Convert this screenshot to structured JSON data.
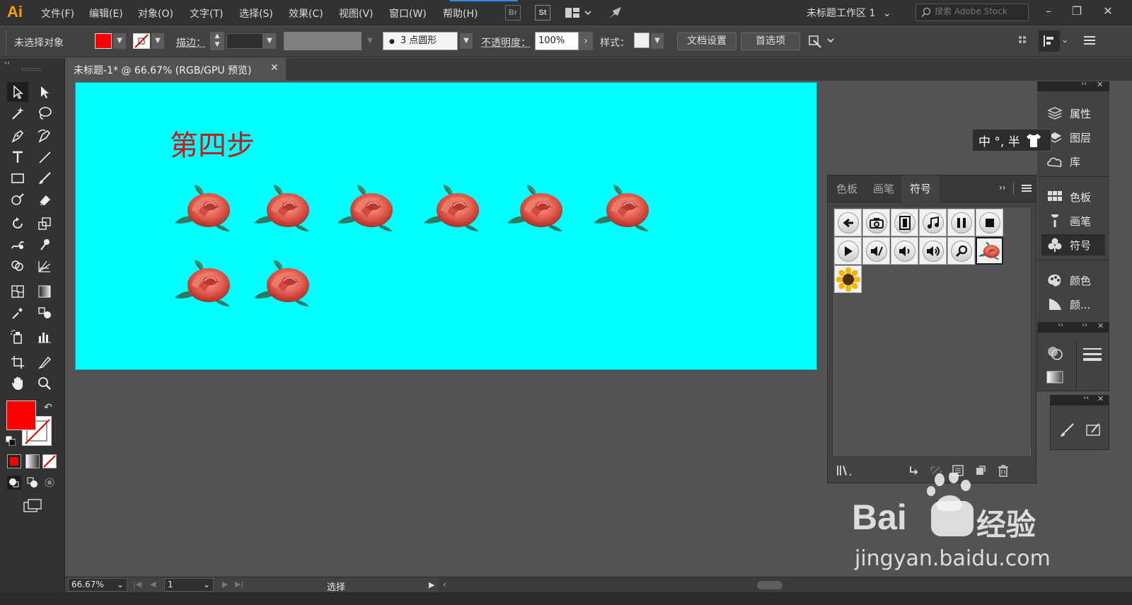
{
  "app": {
    "logo": "Ai"
  },
  "menu": {
    "items": [
      "文件(F)",
      "编辑(E)",
      "对象(O)",
      "文字(T)",
      "选择(S)",
      "效果(C)",
      "视图(V)",
      "窗口(W)",
      "帮助(H)"
    ],
    "bridge_label": "Br",
    "stock_label": "St",
    "workspace": "未标题工作区 1",
    "search_placeholder": "搜索 Adobe Stock"
  },
  "control": {
    "selection_status": "未选择对象",
    "fill_color": "#ff0000",
    "stroke_label": "描边：",
    "brush_profile": "3 点圆形",
    "opacity_label": "不透明度：",
    "opacity_value": "100%",
    "style_label": "样式：",
    "doc_setup_button": "文档设置",
    "preferences_button": "首选项"
  },
  "document": {
    "tab_title": "未标题-1* @ 66.67% (RGB/GPU 预览)",
    "artboard_color": "#00ffff",
    "heading": "第四步",
    "heading_color": "#c01d1d"
  },
  "dock": {
    "items": [
      {
        "label": "属性",
        "icon": "properties-icon"
      },
      {
        "label": "图层",
        "icon": "layers-icon"
      },
      {
        "label": "库",
        "icon": "libraries-icon"
      },
      {
        "label": "色板",
        "icon": "swatches-icon"
      },
      {
        "label": "画笔",
        "icon": "brushes-icon"
      },
      {
        "label": "符号",
        "icon": "symbols-icon"
      },
      {
        "label": "颜色",
        "icon": "color-icon"
      },
      {
        "label": "颜...",
        "icon": "color-guide-icon"
      }
    ],
    "ime_text": "中 °, 半"
  },
  "symbols_panel": {
    "tabs": [
      "色板",
      "画笔",
      "符号"
    ],
    "active_tab": "符号",
    "symbols": [
      "arrow-left-icon",
      "camera-icon",
      "film-icon",
      "music-icon",
      "pause-icon",
      "stop-icon",
      "play-icon",
      "mute-icon",
      "volume-low-icon",
      "volume-high-icon",
      "search-icon",
      "rose-symbol",
      "sunflower-symbol"
    ],
    "selected_symbol": "rose-symbol"
  },
  "status": {
    "zoom": "66.67%",
    "page": "1",
    "tool_status": "选择"
  },
  "watermark": {
    "brand": "Bai",
    "brand2": "经验",
    "url": "jingyan.baidu.com"
  }
}
